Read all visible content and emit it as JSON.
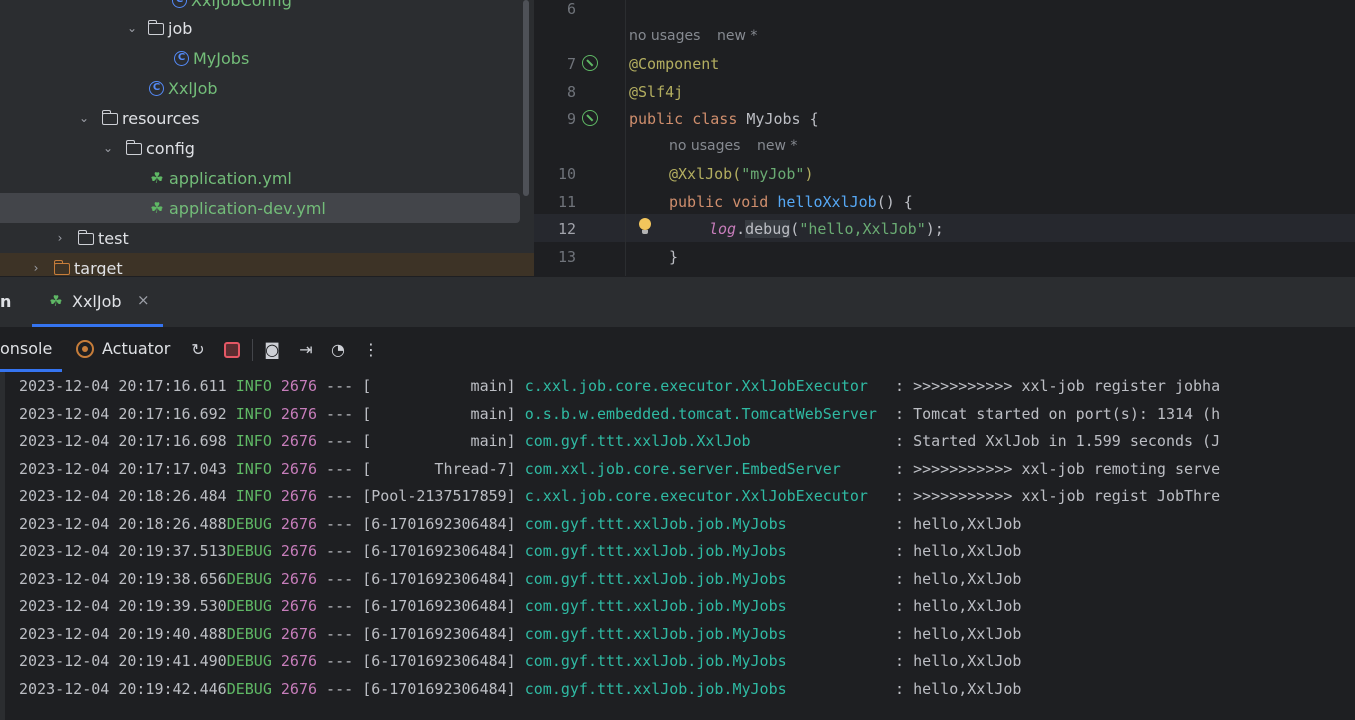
{
  "tree": {
    "items": [
      {
        "label": "XxlJobConfig",
        "kind": "class"
      },
      {
        "label": "job",
        "kind": "package"
      },
      {
        "label": "MyJobs",
        "kind": "class"
      },
      {
        "label": "XxlJob",
        "kind": "spring-class"
      },
      {
        "label": "resources",
        "kind": "resources-folder"
      },
      {
        "label": "config",
        "kind": "folder"
      },
      {
        "label": "application.yml",
        "kind": "spring-config"
      },
      {
        "label": "application-dev.yml",
        "kind": "spring-config"
      },
      {
        "label": "test",
        "kind": "folder"
      },
      {
        "label": "target",
        "kind": "excluded-folder"
      }
    ]
  },
  "editor": {
    "hints": [
      "no usages",
      "new *",
      "no usages",
      "new *"
    ],
    "line_numbers": [
      "6",
      "7",
      "8",
      "9",
      "10",
      "11",
      "12",
      "13"
    ],
    "code": {
      "l7": "@Component",
      "l8": "@Slf4j",
      "l9_kw": "public class ",
      "l9_name": "MyJobs",
      "l9_brace": " {",
      "l10_ann": "@XxlJob(",
      "l10_str": "\"myJob\"",
      "l10_close": ")",
      "l11_kw": "public void ",
      "l11_name": "helloXxlJob",
      "l11_rest": "() {",
      "l12_field": "log",
      "l12_dot": ".",
      "l12_method": "debug",
      "l12_open": "(",
      "l12_str": "\"hello,XxlJob\"",
      "l12_close": ");",
      "l13": "}"
    }
  },
  "run": {
    "window_label": "n",
    "tab_label": "XxlJob",
    "close_glyph": "×",
    "console_tab": "onsole",
    "actuator_tab": "Actuator",
    "more_glyph": "⋮"
  },
  "console": {
    "lines": [
      {
        "ts": "2023-12-04 20:17:16.611",
        "level": " INFO",
        "pid": "2676",
        "sep": " --- ",
        "thread": "[           main]",
        "logger": "c.xxl.job.core.executor.XxlJobExecutor  ",
        "msg": " : >>>>>>>>>>> xxl-job register jobha"
      },
      {
        "ts": "2023-12-04 20:17:16.692",
        "level": " INFO",
        "pid": "2676",
        "sep": " --- ",
        "thread": "[           main]",
        "logger": "o.s.b.w.embedded.tomcat.TomcatWebServer ",
        "msg": " : Tomcat started on port(s): 1314 (h"
      },
      {
        "ts": "2023-12-04 20:17:16.698",
        "level": " INFO",
        "pid": "2676",
        "sep": " --- ",
        "thread": "[           main]",
        "logger": "com.gyf.ttt.xxlJob.XxlJob               ",
        "msg": " : Started XxlJob in 1.599 seconds (J"
      },
      {
        "ts": "2023-12-04 20:17:17.043",
        "level": " INFO",
        "pid": "2676",
        "sep": " --- ",
        "thread": "[       Thread-7]",
        "logger": "com.xxl.job.core.server.EmbedServer     ",
        "msg": " : >>>>>>>>>>> xxl-job remoting serve"
      },
      {
        "ts": "2023-12-04 20:18:26.484",
        "level": " INFO",
        "pid": "2676",
        "sep": " --- ",
        "thread": "[Pool-2137517859]",
        "logger": "c.xxl.job.core.executor.XxlJobExecutor  ",
        "msg": " : >>>>>>>>>>> xxl-job regist JobThre"
      },
      {
        "ts": "2023-12-04 20:18:26.488",
        "level": "DEBUG",
        "pid": "2676",
        "sep": " --- ",
        "thread": "[6-1701692306484]",
        "logger": "com.gyf.ttt.xxlJob.job.MyJobs           ",
        "msg": " : hello,XxlJob"
      },
      {
        "ts": "2023-12-04 20:19:37.513",
        "level": "DEBUG",
        "pid": "2676",
        "sep": " --- ",
        "thread": "[6-1701692306484]",
        "logger": "com.gyf.ttt.xxlJob.job.MyJobs           ",
        "msg": " : hello,XxlJob"
      },
      {
        "ts": "2023-12-04 20:19:38.656",
        "level": "DEBUG",
        "pid": "2676",
        "sep": " --- ",
        "thread": "[6-1701692306484]",
        "logger": "com.gyf.ttt.xxlJob.job.MyJobs           ",
        "msg": " : hello,XxlJob"
      },
      {
        "ts": "2023-12-04 20:19:39.530",
        "level": "DEBUG",
        "pid": "2676",
        "sep": " --- ",
        "thread": "[6-1701692306484]",
        "logger": "com.gyf.ttt.xxlJob.job.MyJobs           ",
        "msg": " : hello,XxlJob"
      },
      {
        "ts": "2023-12-04 20:19:40.488",
        "level": "DEBUG",
        "pid": "2676",
        "sep": " --- ",
        "thread": "[6-1701692306484]",
        "logger": "com.gyf.ttt.xxlJob.job.MyJobs           ",
        "msg": " : hello,XxlJob"
      },
      {
        "ts": "2023-12-04 20:19:41.490",
        "level": "DEBUG",
        "pid": "2676",
        "sep": " --- ",
        "thread": "[6-1701692306484]",
        "logger": "com.gyf.ttt.xxlJob.job.MyJobs           ",
        "msg": " : hello,XxlJob"
      },
      {
        "ts": "2023-12-04 20:19:42.446",
        "level": "DEBUG",
        "pid": "2676",
        "sep": " --- ",
        "thread": "[6-1701692306484]",
        "logger": "com.gyf.ttt.xxlJob.job.MyJobs           ",
        "msg": " : hello,XxlJob"
      }
    ]
  },
  "icons": {
    "tree_class": "class-icon",
    "tree_spring": "spring-boot-icon",
    "toolbar": [
      "rerun-icon",
      "stop-icon",
      "screenshot-icon",
      "exit-icon",
      "performance-icon",
      "more-icon"
    ]
  },
  "colors": {
    "accent": "#3574f0",
    "spring_green": "#5fb865",
    "logger_teal": "#2fbaa3",
    "pid_magenta": "#c77dbb",
    "keyword_orange": "#cf8e6d",
    "annotation_yellow": "#b3ae60",
    "string_green": "#6aab73"
  }
}
